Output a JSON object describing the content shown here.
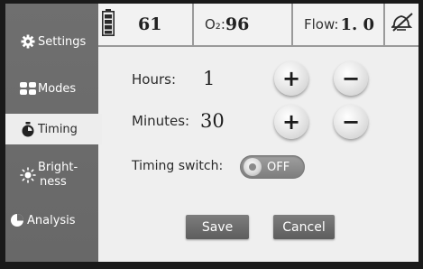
{
  "sidebar": {
    "items": [
      {
        "label": "Settings",
        "icon": "gear-icon"
      },
      {
        "label": "Modes",
        "icon": "modes-icon"
      },
      {
        "label": "Timing",
        "icon": "timer-icon"
      },
      {
        "label_line1": "Bright-",
        "label_line2": "ness",
        "icon": "brightness-icon"
      },
      {
        "label": "Analysis",
        "icon": "pie-chart-icon"
      }
    ],
    "active": "Timing"
  },
  "status_bar": {
    "battery_icon": "battery-icon",
    "pulse_value": "61",
    "o2_label": "O₂:",
    "o2_value": "96",
    "flow_label": "Flow:",
    "flow_value": "1. 0",
    "alarm_icon": "alarm-muted-icon"
  },
  "timing": {
    "hours_label": "Hours:",
    "hours_value": "1",
    "minutes_label": "Minutes:",
    "minutes_value": "30",
    "increment_symbol": "+",
    "decrement_symbol": "−",
    "switch_label": "Timing switch:",
    "switch_state": "OFF"
  },
  "actions": {
    "save_label": "Save",
    "cancel_label": "Cancel"
  },
  "colors": {
    "sidebar_bg": "#6b6b6b",
    "content_bg": "#efefef",
    "button_gray": "#6a6a6a"
  }
}
